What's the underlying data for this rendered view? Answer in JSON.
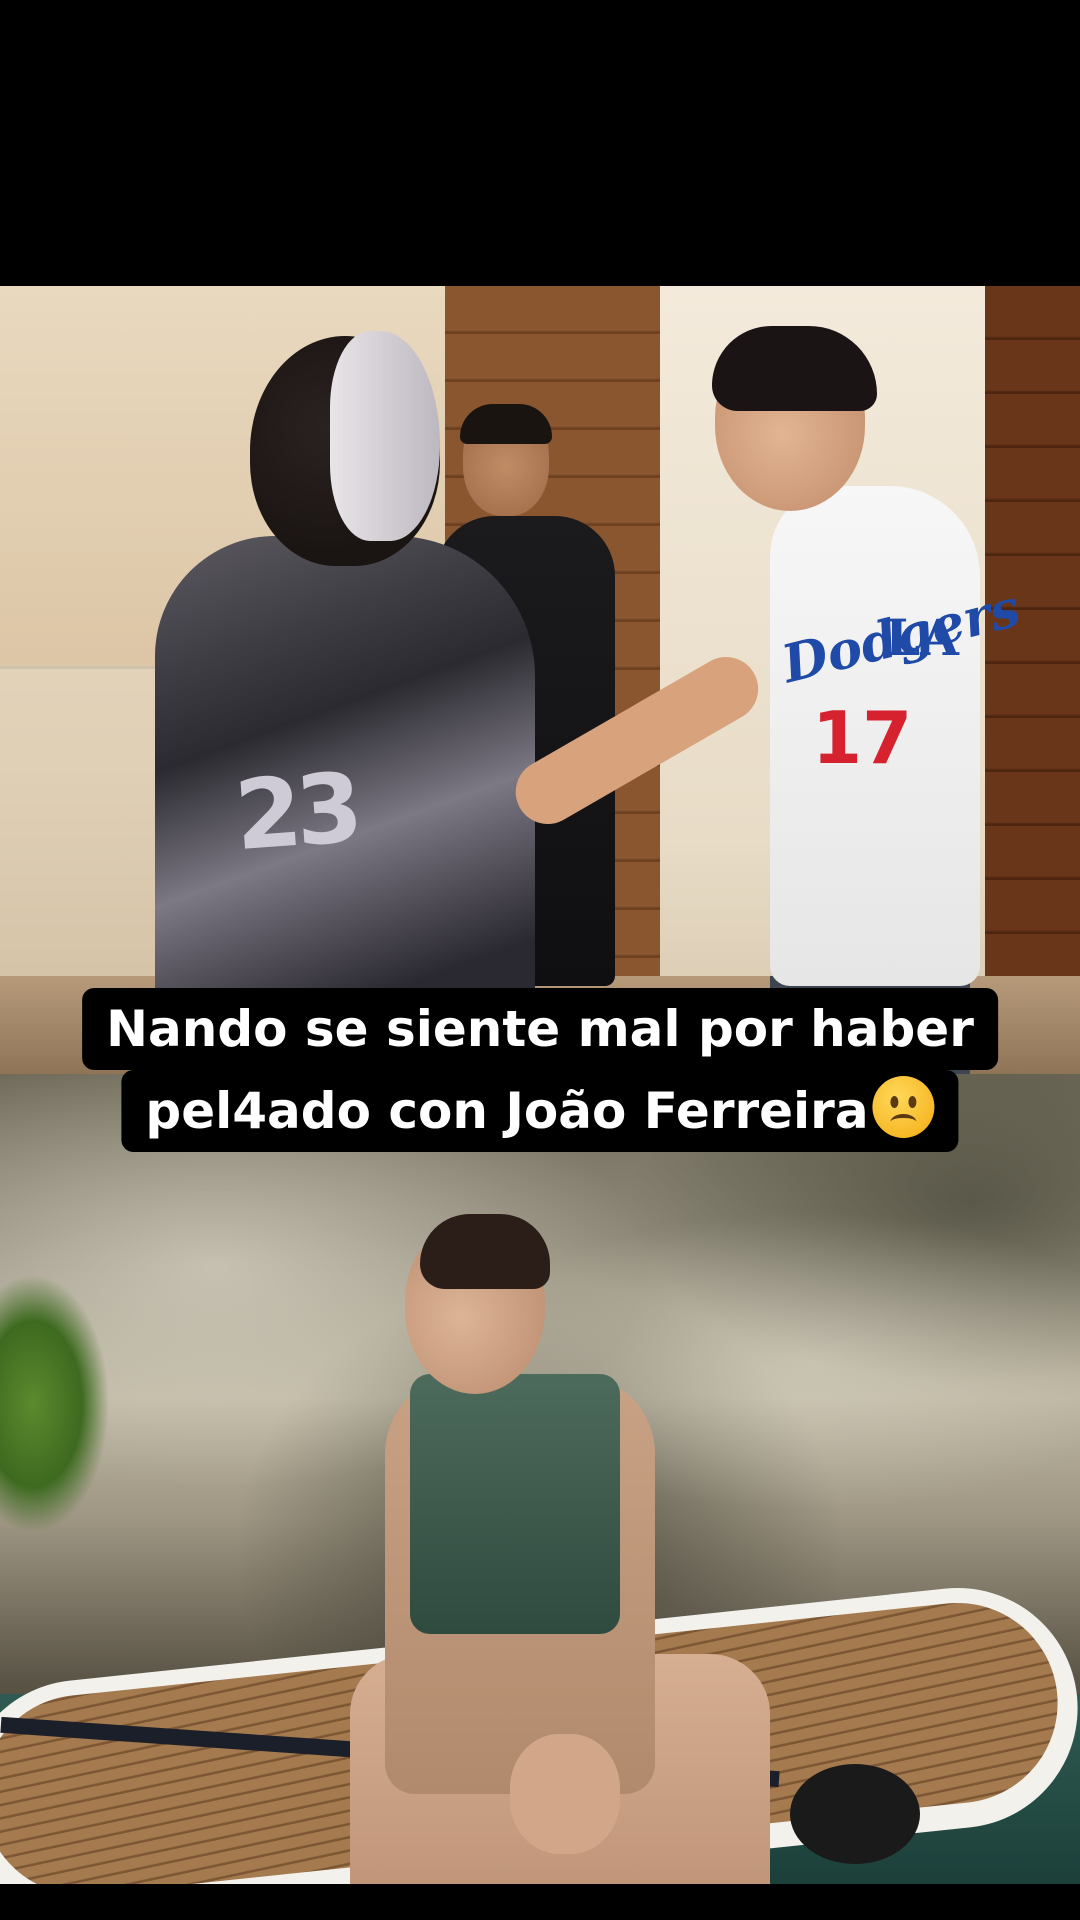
{
  "caption": {
    "line1": "Nando se siente mal por haber",
    "line2": "pel4ado con João Ferreira",
    "emoji": "slightly-frowning-face"
  },
  "top_photo": {
    "jersey_number_left": "23",
    "jersey_text_right": "Dodgers",
    "jersey_logo_right": "LA",
    "jersey_number_right": "17"
  },
  "colors": {
    "caption_background": "#000000",
    "caption_text": "#ffffff",
    "dodgers_blue": "#1f4aa8",
    "dodgers_red": "#d6222e"
  }
}
